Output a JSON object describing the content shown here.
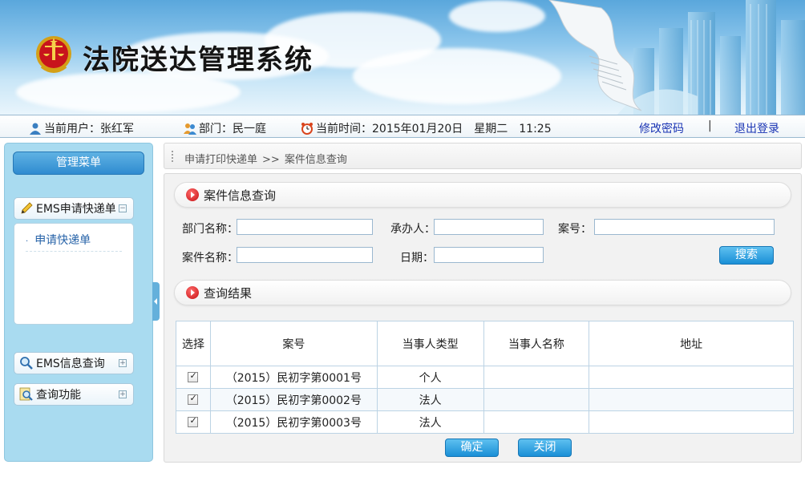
{
  "app": {
    "title": "法院送达管理系统"
  },
  "info": {
    "user_label": "当前用户：张红军",
    "dept_label": "部门：民一庭",
    "time_label": "当前时间：2015年01月20日　星期二　11:25",
    "change_password": "修改密码",
    "separator": "|",
    "logout": "退出登录"
  },
  "sidebar": {
    "menu_title": "管理菜单",
    "groups": [
      {
        "label": "EMS申请快递单",
        "toggle": "⊟",
        "icon": "pencil-icon"
      },
      {
        "label": "EMS信息查询",
        "toggle": "⊞",
        "icon": "magnifier-icon"
      },
      {
        "label": "查询功能",
        "toggle": "⊞",
        "icon": "search-doc-icon"
      }
    ],
    "sub_items": [
      {
        "label": "申请快递单"
      }
    ]
  },
  "breadcrumb": {
    "parent": "申请打印快递单",
    "arrow": ">>",
    "current": "案件信息查询"
  },
  "search_section": {
    "title": "案件信息查询",
    "fields": {
      "dept": {
        "label": "部门名称：",
        "value": ""
      },
      "handler": {
        "label": "承办人：",
        "value": ""
      },
      "case_no": {
        "label": "案号：",
        "value": ""
      },
      "case_name": {
        "label": "案件名称：",
        "value": ""
      },
      "date": {
        "label": "日期：",
        "value": ""
      }
    },
    "search_button": "搜索"
  },
  "results_section": {
    "title": "查询结果",
    "columns": [
      "选择",
      "案号",
      "当事人类型",
      "当事人名称",
      "地址"
    ],
    "rows": [
      {
        "checked": true,
        "case_no": "（2015）民初字第0001号",
        "party_type": "个人",
        "party_name": "",
        "address": ""
      },
      {
        "checked": true,
        "case_no": "（2015）民初字第0002号",
        "party_type": "法人",
        "party_name": "",
        "address": ""
      },
      {
        "checked": true,
        "case_no": "（2015）民初字第0003号",
        "party_type": "法人",
        "party_name": "",
        "address": ""
      }
    ],
    "confirm_button": "确定",
    "close_button": "关闭"
  },
  "colors": {
    "accent_blue": "#1a8fd6",
    "sidebar_bg": "#a9dbf0",
    "link": "#1a34b4",
    "bullet_red": "#c60f12"
  }
}
